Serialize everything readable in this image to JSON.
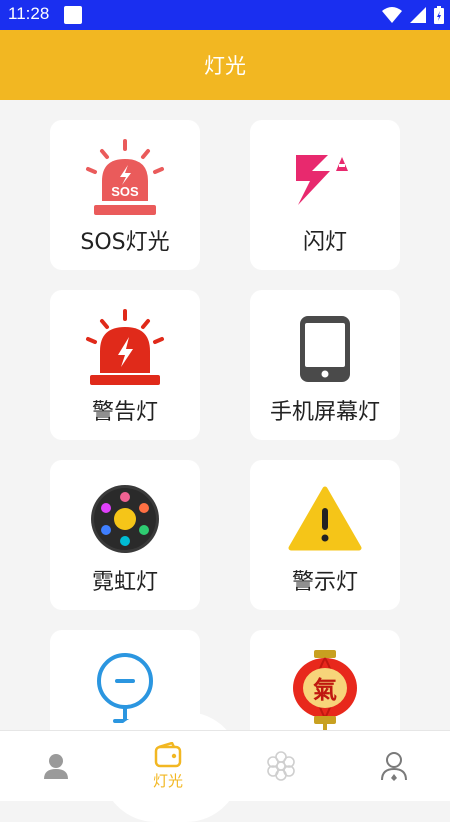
{
  "status_bar": {
    "time": "11:28"
  },
  "app_bar": {
    "title": "灯光"
  },
  "cards": [
    {
      "label": "SOS灯光",
      "icon": "sos-siren-icon",
      "badge": "SOS"
    },
    {
      "label": "闪灯",
      "icon": "flash-icon"
    },
    {
      "label": "警告灯",
      "icon": "warning-siren-icon"
    },
    {
      "label": "手机屏幕灯",
      "icon": "phone-screen-icon"
    },
    {
      "label": "霓虹灯",
      "icon": "neon-light-icon"
    },
    {
      "label": "警示灯",
      "icon": "caution-triangle-icon"
    },
    {
      "label": "",
      "icon": "magnifier-light-icon"
    },
    {
      "label": "",
      "icon": "lantern-icon",
      "badge": "氣"
    }
  ],
  "tabs": [
    {
      "label": "",
      "icon": "user-profile-icon"
    },
    {
      "label": "灯光",
      "icon": "wallet-light-icon",
      "active": true
    },
    {
      "label": "",
      "icon": "flower-icon"
    },
    {
      "label": "",
      "icon": "person-pin-icon"
    }
  ],
  "colors": {
    "accent": "#f2b722",
    "status_bar": "#1a2ff0",
    "sos_red": "#ea5b5b",
    "flash_pink": "#e8296e",
    "alarm_red": "#e02a1a",
    "icon_blue": "#2b96e0"
  }
}
